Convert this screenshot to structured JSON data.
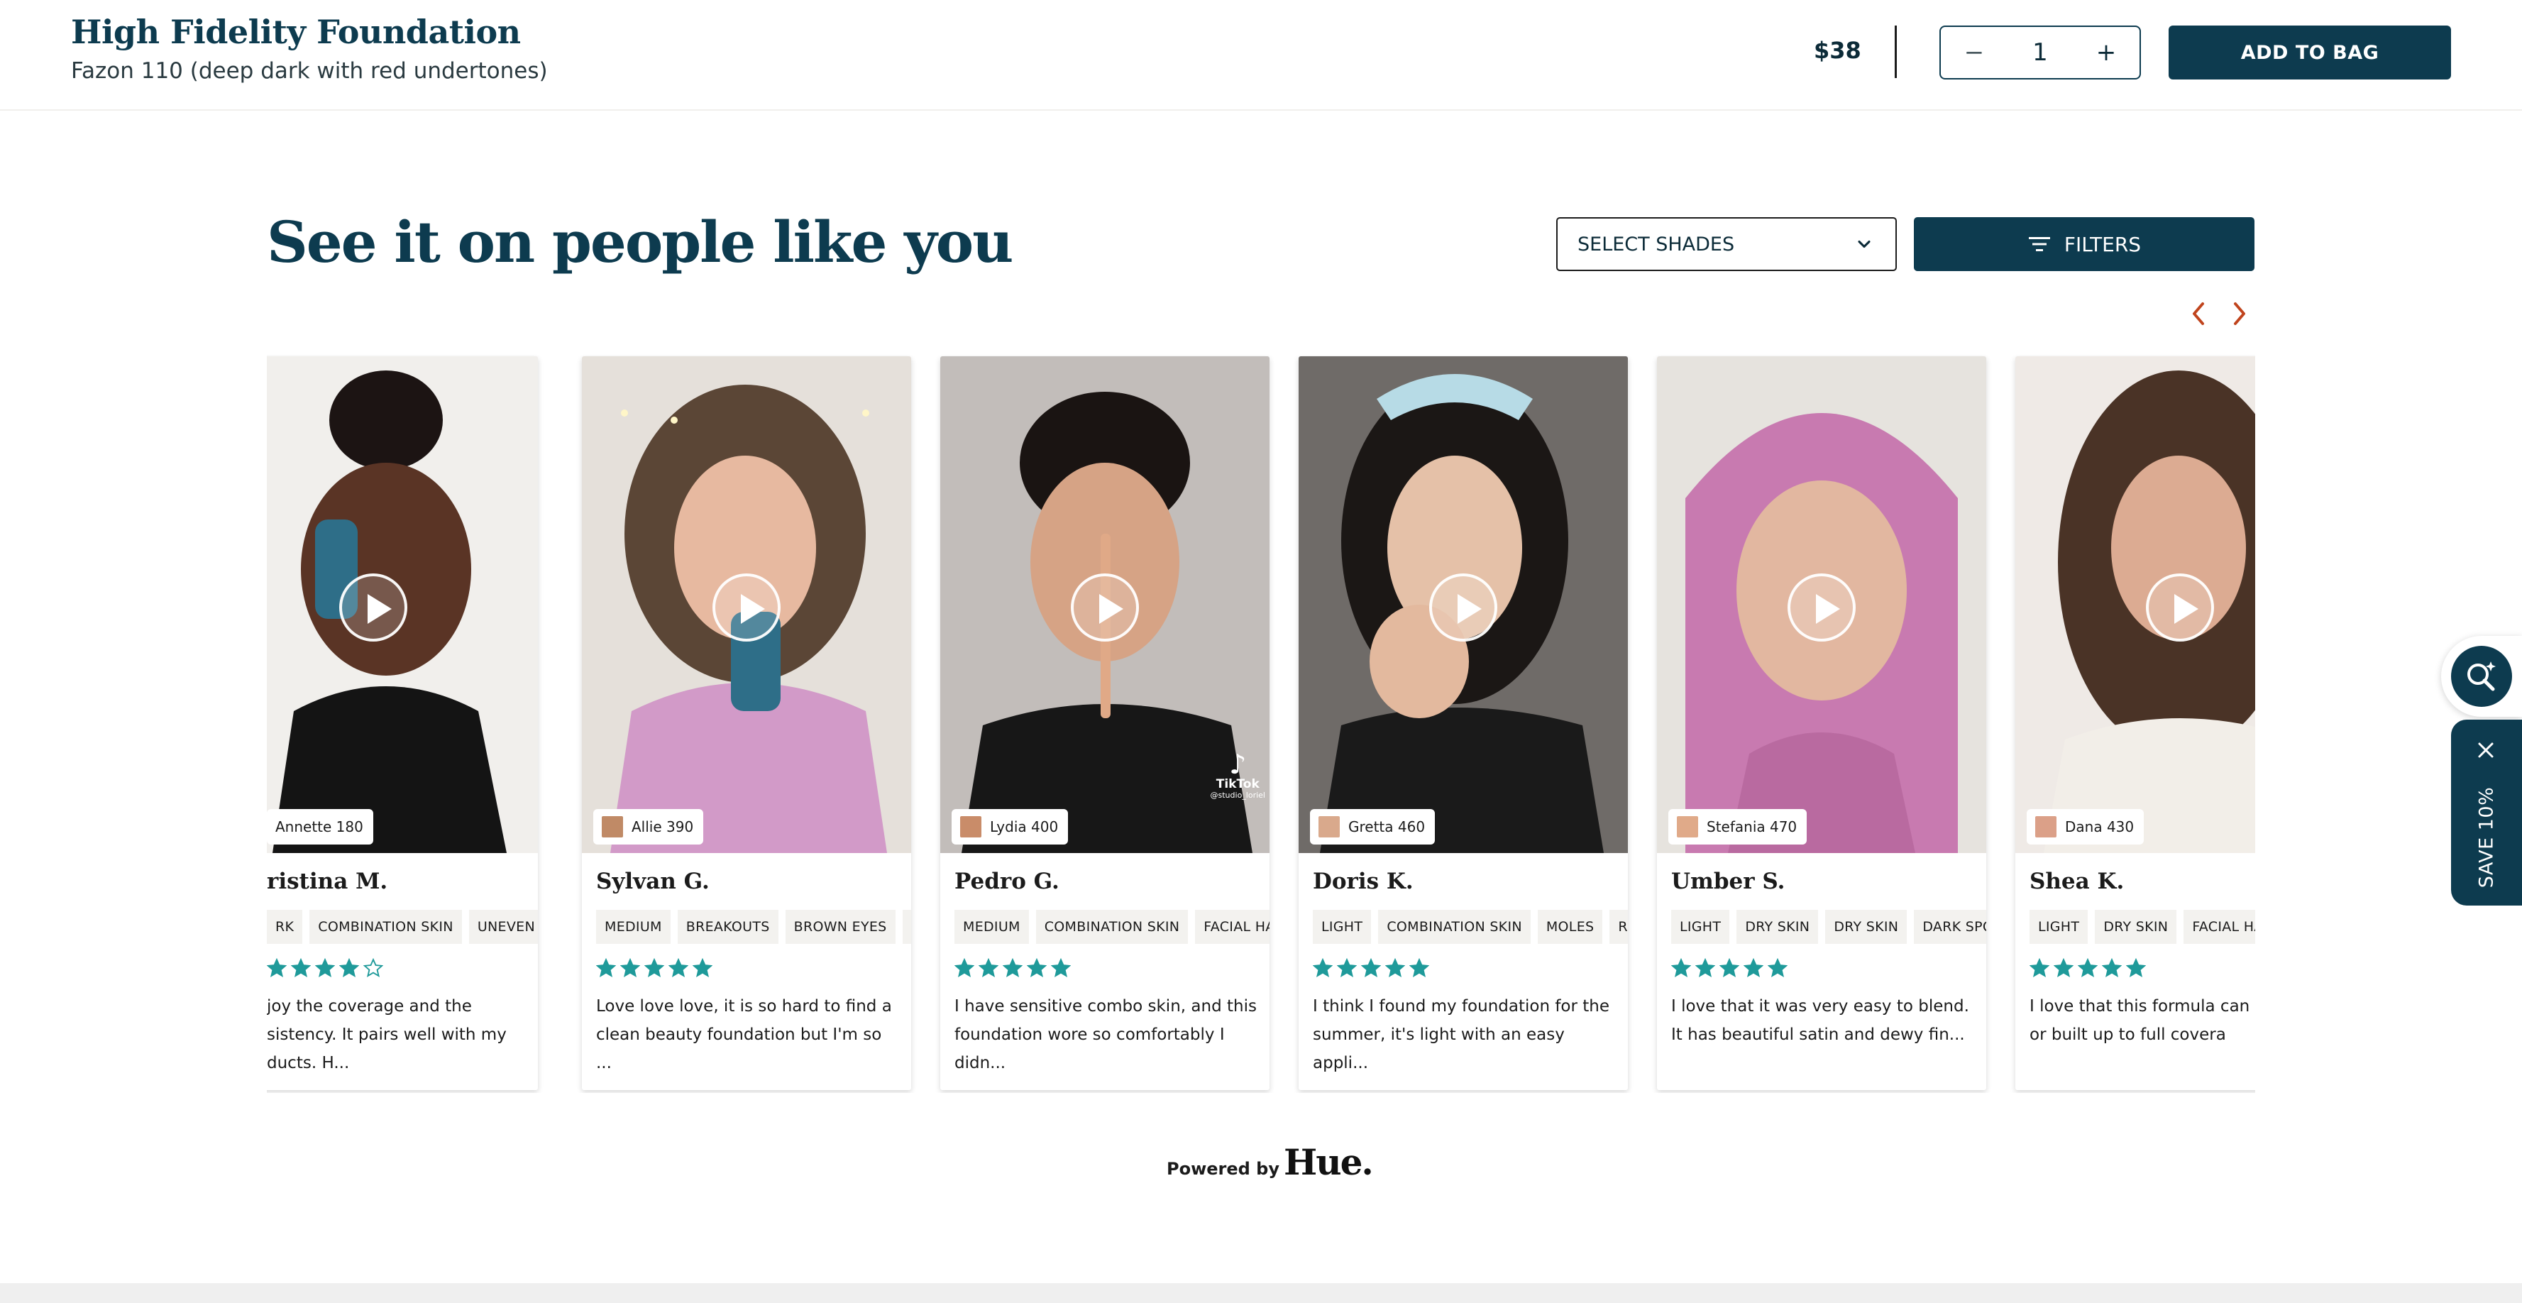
{
  "header": {
    "product_title": "High Fidelity Foundation",
    "shade_subtitle": "Fazon 110 (deep dark with red undertones)",
    "price": "$38",
    "quantity": "1",
    "qty_minus": "−",
    "qty_plus": "+",
    "add_to_bag": "ADD TO BAG"
  },
  "section": {
    "title": "See it on people like you",
    "select_shades": "SELECT SHADES",
    "filters": "FILTERS",
    "prev_icon": "chevron-left-icon",
    "next_icon": "chevron-right-icon"
  },
  "colors": {
    "brand": "#0d3b4f",
    "star": "#1f9a9a",
    "tag_bg": "#f3f2ef",
    "nav_arrow": "#c0441d"
  },
  "cards": [
    {
      "shade": "Annette 180",
      "shade_color": "",
      "name": "ristina M.",
      "tags": [
        "RK",
        "COMBINATION SKIN",
        "UNEVEN TEX"
      ],
      "rating": 4,
      "review": "joy the coverage and the\nsistency. It pairs well with my\nducts. H..."
    },
    {
      "shade": "Allie 390",
      "shade_color": "#c08a66",
      "name": "Sylvan G.",
      "tags": [
        "MEDIUM",
        "BREAKOUTS",
        "BROWN EYES",
        "I"
      ],
      "rating": 5,
      "review": "Love love love, it is so hard to find a clean beauty foundation but I'm so ..."
    },
    {
      "shade": "Lydia 400",
      "shade_color": "#c98c69",
      "name": "Pedro G.",
      "tags": [
        "MEDIUM",
        "COMBINATION SKIN",
        "FACIAL HA"
      ],
      "rating": 5,
      "review": "I have sensitive combo skin, and this foundation wore so comfortably I didn..."
    },
    {
      "shade": "Gretta 460",
      "shade_color": "#d9a98c",
      "name": "Doris K.",
      "tags": [
        "LIGHT",
        "COMBINATION SKIN",
        "MOLES",
        "R"
      ],
      "rating": 5,
      "review": "I think I found my foundation for the summer, it's light with an easy appli..."
    },
    {
      "shade": "Stefania 470",
      "shade_color": "#e0aa89",
      "name": "Umber S.",
      "tags": [
        "LIGHT",
        "DRY SKIN",
        "DRY SKIN",
        "DARK SPO"
      ],
      "rating": 5,
      "review": "I love that it was very easy to blend. It has beautiful satin and dewy fin..."
    },
    {
      "shade": "Dana 430",
      "shade_color": "#dba088",
      "name": "Shea K.",
      "tags": [
        "LIGHT",
        "DRY SKIN",
        "FACIAL HAI"
      ],
      "rating": 5,
      "review": "I love that this formula can be sheer, or built up to full covera"
    }
  ],
  "tiktok": {
    "label": "TikTok",
    "handle": "@studio_loriel"
  },
  "footer": {
    "powered_by": "Powered by",
    "brand": "Hue."
  },
  "floating": {
    "search_icon": "search-sparkle-icon",
    "save_label": "SAVE 10%",
    "close_icon": "close-icon"
  }
}
